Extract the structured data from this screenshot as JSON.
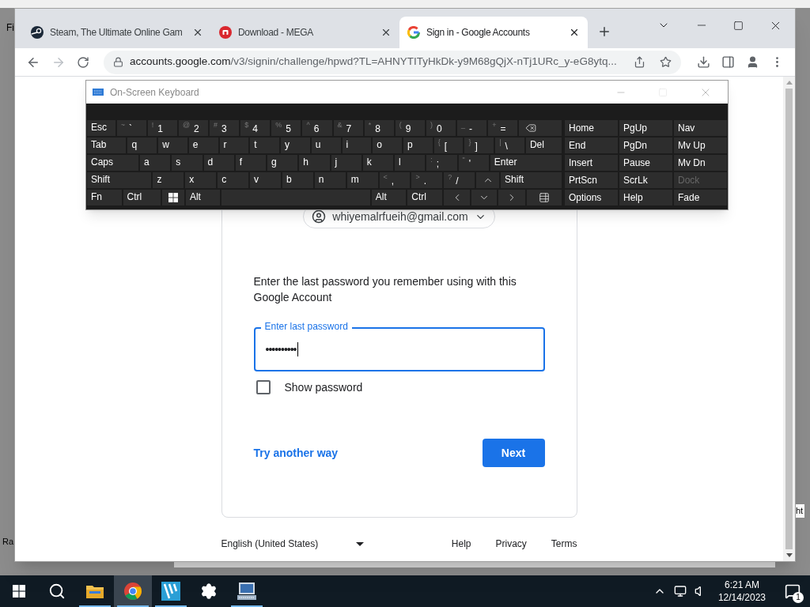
{
  "background_app": {
    "fragments": [
      "Fi",
      "Ra",
      "ht"
    ]
  },
  "browser": {
    "tabs": [
      {
        "kind": "steam",
        "title": "Steam, The Ultimate Online Gam",
        "selected": false
      },
      {
        "kind": "mega",
        "title": "Download - MEGA",
        "selected": false
      },
      {
        "kind": "google",
        "title": "Sign in - Google Accounts",
        "selected": true
      }
    ],
    "url_host": "accounts.google.com",
    "url_path": "/v3/signin/challenge/hpwd?TL=AHNYTITyHkDk-y9M68gQjX-nTj1URc_y-eG8ytq..."
  },
  "page": {
    "account": "whiyemalrfueih@gmail.com",
    "prompt": "Enter the last password you remember using with this Google Account",
    "password": {
      "label": "Enter last password",
      "value": "••••••••••"
    },
    "show_password": {
      "label": "Show password",
      "checked": false
    },
    "secondary_action": "Try another way",
    "primary_action": "Next",
    "language": "English (United States)",
    "footer_links": [
      "Help",
      "Privacy",
      "Terms"
    ]
  },
  "keyboard": {
    "title": "On-Screen Keyboard",
    "rows": [
      {
        "keys": [
          {
            "kind": "key",
            "label": "Esc"
          },
          {
            "kind": "key",
            "label": "`",
            "shift": "~"
          },
          {
            "kind": "key",
            "label": "1",
            "shift": "!"
          },
          {
            "kind": "key",
            "label": "2",
            "shift": "@"
          },
          {
            "kind": "key",
            "label": "3",
            "shift": "#"
          },
          {
            "kind": "key",
            "label": "4",
            "shift": "$"
          },
          {
            "kind": "key",
            "label": "5",
            "shift": "%"
          },
          {
            "kind": "key",
            "label": "6",
            "shift": "^"
          },
          {
            "kind": "key",
            "label": "7",
            "shift": "&"
          },
          {
            "kind": "key",
            "label": "8",
            "shift": "*"
          },
          {
            "kind": "key",
            "label": "9",
            "shift": "("
          },
          {
            "kind": "key",
            "label": "0",
            "shift": ")"
          },
          {
            "kind": "key",
            "label": "-",
            "shift": "_"
          },
          {
            "kind": "key",
            "label": "=",
            "shift": "+"
          },
          {
            "kind": "backspace"
          }
        ]
      },
      {
        "keys": [
          {
            "kind": "key",
            "label": "Tab"
          },
          {
            "kind": "key",
            "label": "q"
          },
          {
            "kind": "key",
            "label": "w"
          },
          {
            "kind": "key",
            "label": "e"
          },
          {
            "kind": "key",
            "label": "r"
          },
          {
            "kind": "key",
            "label": "t"
          },
          {
            "kind": "key",
            "label": "y"
          },
          {
            "kind": "key",
            "label": "u"
          },
          {
            "kind": "key",
            "label": "i"
          },
          {
            "kind": "key",
            "label": "o"
          },
          {
            "kind": "key",
            "label": "p"
          },
          {
            "kind": "key",
            "label": "[",
            "shift": "{"
          },
          {
            "kind": "key",
            "label": "]",
            "shift": "}"
          },
          {
            "kind": "key",
            "label": "\\",
            "shift": "|"
          },
          {
            "kind": "key",
            "label": "Del"
          }
        ]
      },
      {
        "keys": [
          {
            "kind": "key",
            "label": "Caps"
          },
          {
            "kind": "key",
            "label": "a"
          },
          {
            "kind": "key",
            "label": "s"
          },
          {
            "kind": "key",
            "label": "d"
          },
          {
            "kind": "key",
            "label": "f"
          },
          {
            "kind": "key",
            "label": "g"
          },
          {
            "kind": "key",
            "label": "h"
          },
          {
            "kind": "key",
            "label": "j"
          },
          {
            "kind": "key",
            "label": "k"
          },
          {
            "kind": "key",
            "label": "l"
          },
          {
            "kind": "key",
            "label": ";",
            "shift": ":"
          },
          {
            "kind": "key",
            "label": "'",
            "shift": "\""
          },
          {
            "kind": "key",
            "label": "Enter"
          }
        ]
      },
      {
        "keys": [
          {
            "kind": "key",
            "label": "Shift"
          },
          {
            "kind": "key",
            "label": "z"
          },
          {
            "kind": "key",
            "label": "x"
          },
          {
            "kind": "key",
            "label": "c"
          },
          {
            "kind": "key",
            "label": "v"
          },
          {
            "kind": "key",
            "label": "b"
          },
          {
            "kind": "key",
            "label": "n"
          },
          {
            "kind": "key",
            "label": "m"
          },
          {
            "kind": "key",
            "label": ",",
            "shift": "<"
          },
          {
            "kind": "key",
            "label": ".",
            "shift": ">"
          },
          {
            "kind": "key",
            "label": "/",
            "shift": "?"
          },
          {
            "kind": "up"
          },
          {
            "kind": "key",
            "label": "Shift"
          }
        ]
      },
      {
        "keys": [
          {
            "kind": "key",
            "label": "Fn"
          },
          {
            "kind": "key",
            "label": "Ctrl"
          },
          {
            "kind": "windows"
          },
          {
            "kind": "key",
            "label": "Alt"
          },
          {
            "kind": "space"
          },
          {
            "kind": "key",
            "label": "Alt"
          },
          {
            "kind": "key",
            "label": "Ctrl"
          },
          {
            "kind": "left"
          },
          {
            "kind": "down"
          },
          {
            "kind": "right"
          },
          {
            "kind": "menu"
          }
        ]
      }
    ],
    "nav_keys": [
      {
        "label": "Home",
        "disabled": false
      },
      {
        "label": "PgUp",
        "disabled": false
      },
      {
        "label": "Nav",
        "disabled": false
      },
      {
        "label": "End",
        "disabled": false
      },
      {
        "label": "PgDn",
        "disabled": false
      },
      {
        "label": "Mv Up",
        "disabled": false
      },
      {
        "label": "Insert",
        "disabled": false
      },
      {
        "label": "Pause",
        "disabled": false
      },
      {
        "label": "Mv Dn",
        "disabled": false
      },
      {
        "label": "PrtScn",
        "disabled": false
      },
      {
        "label": "ScrLk",
        "disabled": false
      },
      {
        "label": "Dock",
        "disabled": true
      },
      {
        "label": "Options",
        "disabled": false
      },
      {
        "label": "Help",
        "disabled": false
      },
      {
        "label": "Fade",
        "disabled": false
      }
    ]
  },
  "taskbar": {
    "items": [
      {
        "kind": "start",
        "selected": false,
        "running": false
      },
      {
        "kind": "search",
        "selected": false,
        "running": false
      },
      {
        "kind": "explorer",
        "selected": false,
        "running": true
      },
      {
        "kind": "chrome",
        "selected": true,
        "running": true
      },
      {
        "kind": "vegas",
        "selected": false,
        "running": true
      },
      {
        "kind": "settings",
        "selected": false,
        "running": false
      },
      {
        "kind": "osk",
        "selected": false,
        "running": true
      }
    ],
    "time": "6:21 AM",
    "date": "12/14/2023",
    "notifications": "1"
  }
}
